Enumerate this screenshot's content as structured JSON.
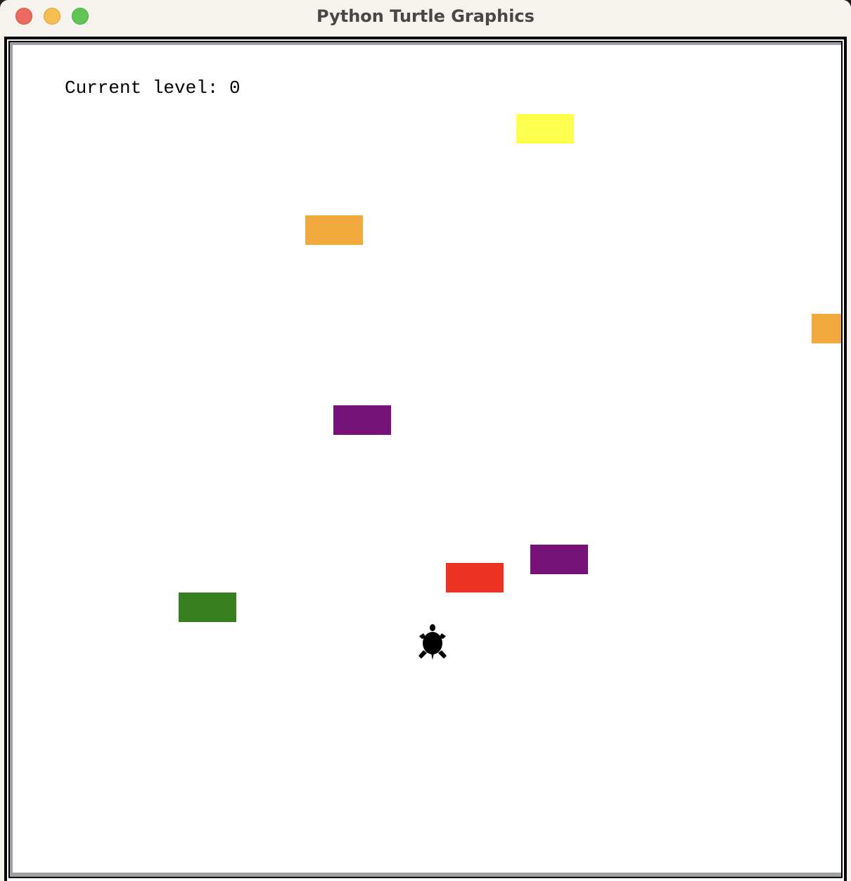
{
  "window": {
    "title": "Python Turtle Graphics",
    "buttons": [
      "close",
      "minimize",
      "zoom"
    ]
  },
  "game": {
    "level_label": "Current level: 0",
    "level": 0,
    "player_icon": "turtle-icon",
    "player_color": "#000000",
    "background_color": "#ffffff",
    "cars": [
      {
        "color": "yellow",
        "hex": "#ffff4d"
      },
      {
        "color": "orange",
        "hex": "#f2a93c"
      },
      {
        "color": "orange",
        "hex": "#f2a93c"
      },
      {
        "color": "purple",
        "hex": "#771378"
      },
      {
        "color": "purple",
        "hex": "#771378"
      },
      {
        "color": "red",
        "hex": "#ea3323"
      },
      {
        "color": "green",
        "hex": "#367e1f"
      }
    ]
  }
}
